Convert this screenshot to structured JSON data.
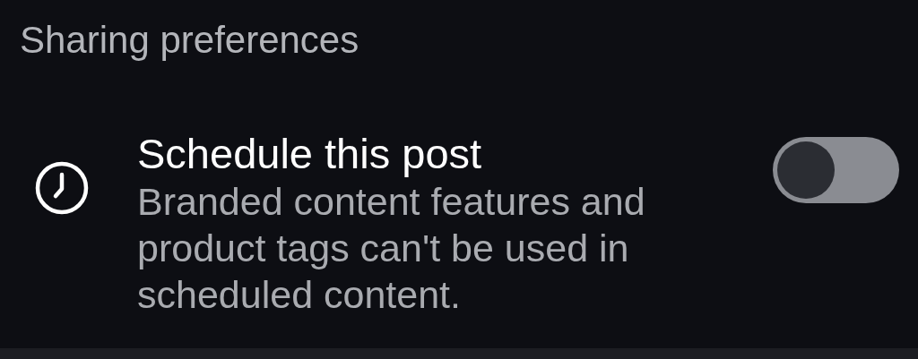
{
  "section": {
    "title": "Sharing preferences"
  },
  "setting": {
    "title": "Schedule this post",
    "description": "Branded content features and product tags can't be used in scheduled content.",
    "on": false
  }
}
